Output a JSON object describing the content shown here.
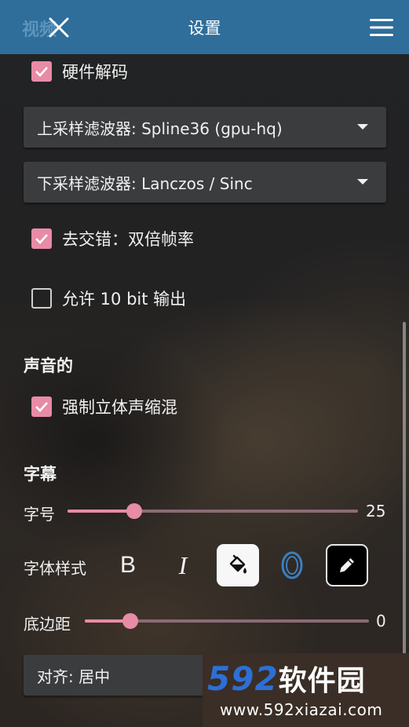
{
  "header": {
    "behind_text": "视频",
    "title": "设置"
  },
  "video": {
    "hardware_decoding": {
      "label": "硬件解码",
      "checked": true
    },
    "upscale_filter": {
      "label": "上采样滤波器: Spline36 (gpu-hq)"
    },
    "downscale_filter": {
      "label": "下采样滤波器: Lanczos / Sinc"
    },
    "deinterlace": {
      "label": "去交错：双倍帧率",
      "checked": true
    },
    "allow_10bit": {
      "label": "允许 10 bit 输出",
      "checked": false
    }
  },
  "audio": {
    "section_title": "声音的",
    "force_stereo_downmix": {
      "label": "强制立体声缩混",
      "checked": true
    }
  },
  "subtitles": {
    "section_title": "字幕",
    "font_size": {
      "label": "字号",
      "value": "25",
      "fraction": 0.23
    },
    "font_style": {
      "label": "字体样式",
      "bold": "B",
      "italic": "I"
    },
    "bottom_margin": {
      "label": "底边距",
      "value": "0",
      "fraction": 0.16
    },
    "align": {
      "label": "对齐: 居中"
    }
  },
  "watermark": {
    "number": "592",
    "name": "软件园",
    "url": "www.592xiazai.com"
  },
  "colors": {
    "accent": "#e88ba6",
    "header": "#2f6d9a",
    "watermark_blue": "#2d6fd6"
  },
  "icons": {
    "close": "close-icon",
    "menu": "hamburger-menu-icon",
    "fill": "paint-bucket-icon",
    "outline": "outline-o-icon",
    "pen": "pencil-icon"
  }
}
